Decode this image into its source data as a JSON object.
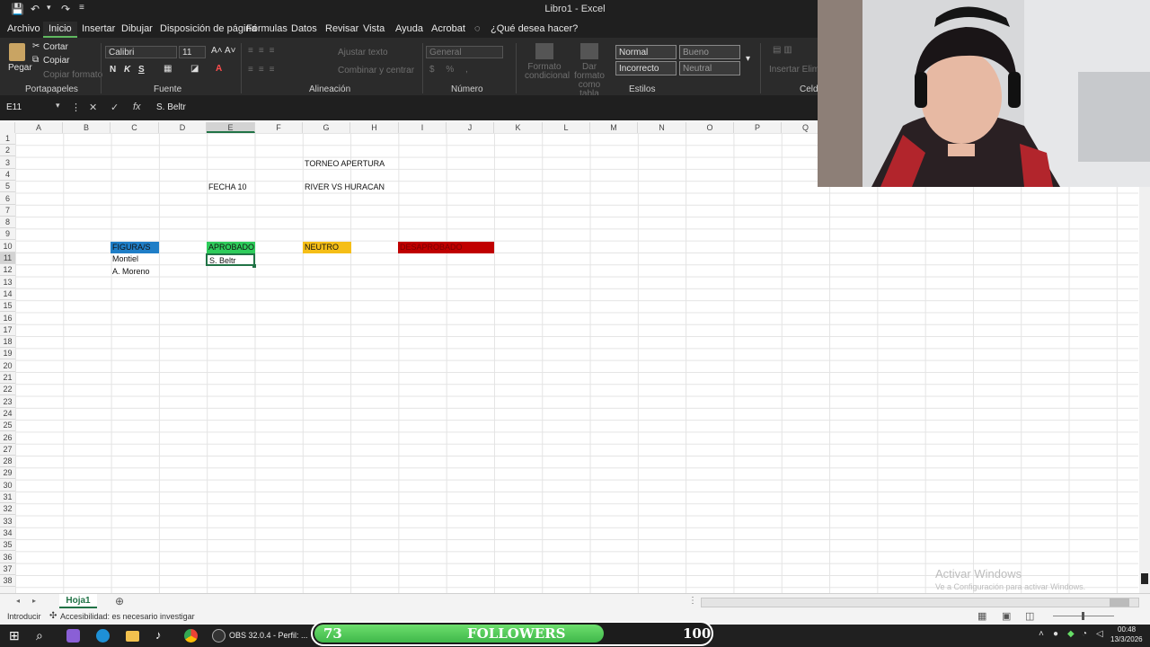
{
  "window": {
    "title": "Libro1  -  Excel"
  },
  "menu": {
    "tabs": [
      "Archivo",
      "Inicio",
      "Insertar",
      "Dibujar",
      "Disposición de página",
      "Fórmulas",
      "Datos",
      "Revisar",
      "Vista",
      "Ayuda",
      "Acrobat"
    ],
    "search_placeholder": "¿Qué desea hacer?"
  },
  "ribbon": {
    "clipboard": {
      "paste": "Pegar",
      "cut": "Cortar",
      "copy": "Copiar",
      "format_painter": "Copiar formato",
      "group": "Portapapeles"
    },
    "font": {
      "name": "Calibri",
      "size": "11",
      "bold": "N",
      "italic": "K",
      "underline": "S",
      "group": "Fuente"
    },
    "alignment": {
      "wrap": "Ajustar texto",
      "merge": "Combinar y centrar",
      "group": "Alineación"
    },
    "number": {
      "format": "General",
      "group": "Número"
    },
    "styles": {
      "cond_format": "Formato condicional",
      "table_format": "Dar formato como tabla",
      "normal": "Normal",
      "bueno": "Bueno",
      "incorrecto": "Incorrecto",
      "neutral": "Neutral",
      "group": "Estilos"
    },
    "cells": {
      "insert_delete": "Insertar Eliminar",
      "group": "Celdas"
    }
  },
  "formula_bar": {
    "name_box": "E11",
    "value": "S. Beltr"
  },
  "columns": [
    "A",
    "B",
    "C",
    "D",
    "E",
    "F",
    "G",
    "H",
    "I",
    "J",
    "K",
    "L",
    "M",
    "N",
    "O",
    "P",
    "Q"
  ],
  "rows": [
    "1",
    "2",
    "3",
    "4",
    "5",
    "6",
    "7",
    "8",
    "9",
    "10",
    "11",
    "12",
    "13",
    "14",
    "15",
    "16",
    "17",
    "18",
    "19",
    "20",
    "21",
    "22",
    "23",
    "24",
    "25",
    "26",
    "27",
    "28",
    "29",
    "30",
    "31",
    "32",
    "33",
    "34",
    "35",
    "36",
    "37",
    "38"
  ],
  "cells": {
    "g3": "TORNEO APERTURA",
    "e5": "FECHA 10",
    "g5": "RIVER VS HURACAN",
    "c10": "FIGURA/S",
    "e10": "APROBADO",
    "g10": "NEUTRO",
    "i10": "DESAPROBADO",
    "c11": "Montiel",
    "e11": "S. Beltr",
    "c12": "A. Moreno"
  },
  "colors": {
    "figura": "#1f7ec7",
    "aprobado": "#2ecc5b",
    "neutro": "#f5be17",
    "desaprobado": "#c00000",
    "excel_green": "#217346"
  },
  "sheet": {
    "tab": "Hoja1"
  },
  "status": {
    "mode": "Introducir",
    "accessibility": "Accesibilidad: es necesario investigar"
  },
  "watermark": {
    "line1": "Activar Windows",
    "line2": "Ve a Configuración para activar Windows."
  },
  "taskbar": {
    "obs": "OBS 32.0.4 - Perfil: ...",
    "followers_count": "73",
    "followers_label": "FOLLOWERS",
    "followers_goal": "100",
    "time": "00:48",
    "date": "13/3/2026"
  }
}
